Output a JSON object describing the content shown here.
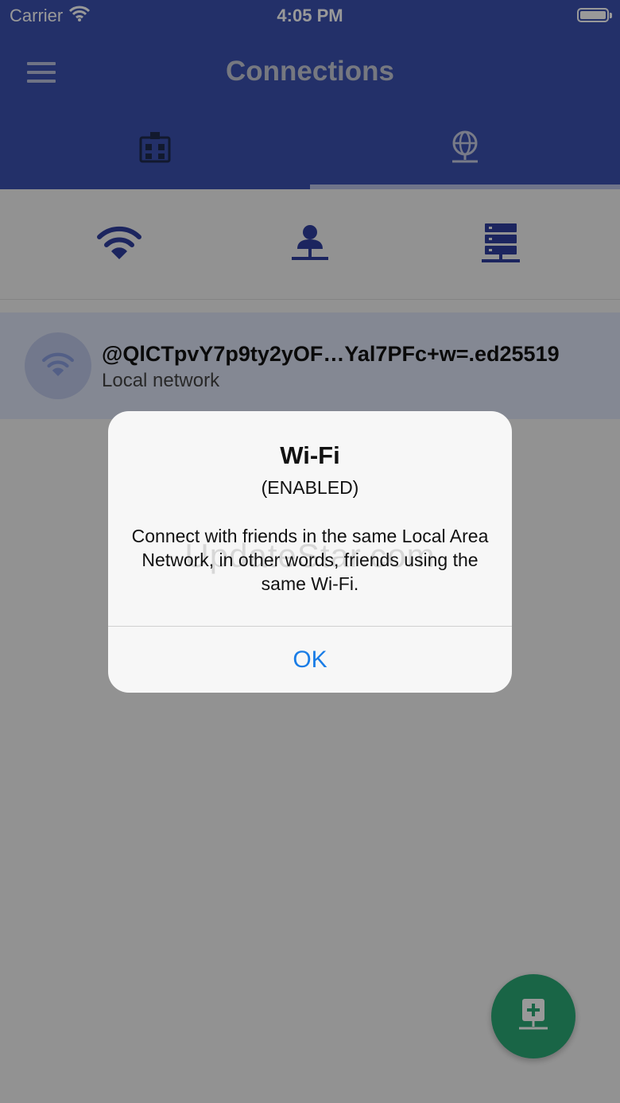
{
  "status_bar": {
    "carrier": "Carrier",
    "time": "4:05 PM"
  },
  "header": {
    "title": "Connections"
  },
  "tabs": [
    {
      "icon": "building-icon"
    },
    {
      "icon": "globe-network-icon",
      "selected": true
    }
  ],
  "subtabs": [
    {
      "icon": "wifi-icon"
    },
    {
      "icon": "person-network-icon"
    },
    {
      "icon": "server-icon"
    }
  ],
  "connections": [
    {
      "title": "@QlCTpvY7p9ty2yOF…Yal7PFc+w=.ed25519",
      "subtitle": "Local network",
      "icon": "wifi-icon"
    }
  ],
  "dialog": {
    "title": "Wi-Fi",
    "subtitle": "(ENABLED)",
    "message": "Connect with friends in the same Local Area Network, in other words, friends using the same Wi-Fi.",
    "ok_label": "OK",
    "watermark": "UpdateStar.com"
  },
  "fab": {
    "icon": "add-server-icon"
  },
  "colors": {
    "primary": "#3b50b0",
    "accent": "#2aa876",
    "link": "#1a7de6"
  }
}
